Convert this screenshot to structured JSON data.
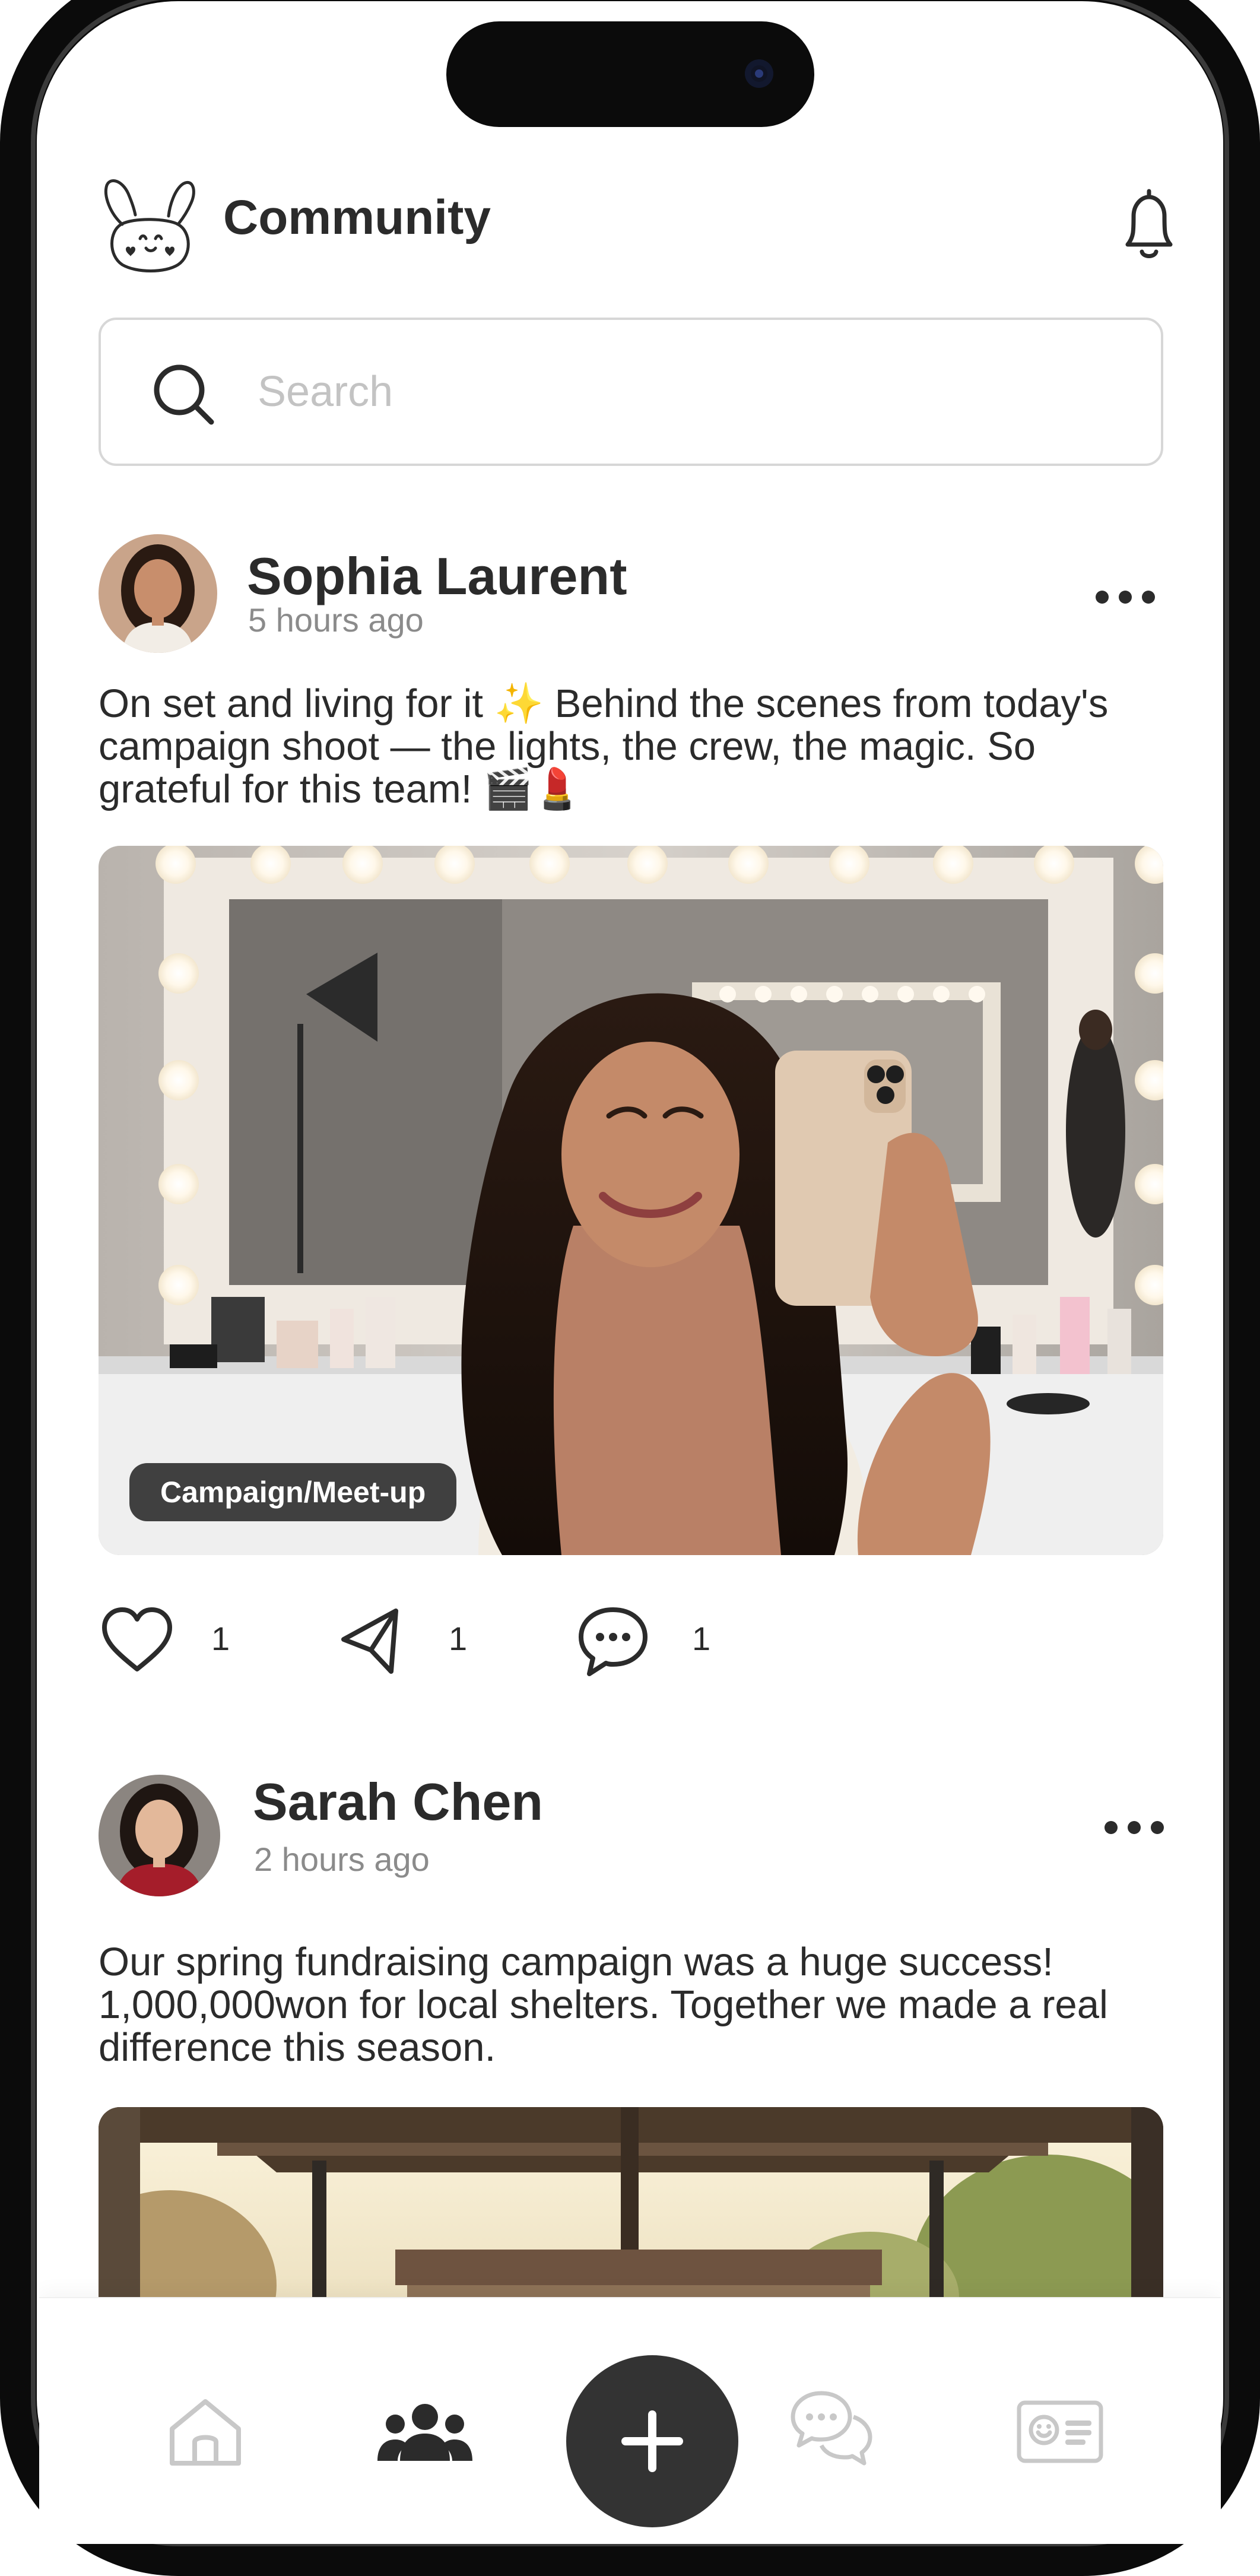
{
  "header": {
    "title": "Community",
    "logo_icon": "bunny-logo-icon",
    "notification_icon": "bell-icon"
  },
  "search": {
    "placeholder": "Search",
    "value": ""
  },
  "posts": [
    {
      "author": "Sophia Laurent",
      "time": "5 hours ago",
      "text": "On set and living for it ✨ Behind the scenes from today's campaign shoot — the lights, the crew, the magic. So grateful for this team! 🎬💄",
      "image_tag": "Campaign/Meet-up",
      "likes": "1",
      "shares": "1",
      "comments": "1"
    },
    {
      "author": "Sarah Chen",
      "time": "2 hours ago",
      "text": "Our spring fundraising campaign was a huge success! 1,000,000won for local shelters. Together we made a real difference this season."
    }
  ],
  "tabbar": {
    "tabs": [
      {
        "name": "home",
        "icon": "home-icon",
        "active": false
      },
      {
        "name": "community",
        "icon": "people-icon",
        "active": true
      },
      {
        "name": "create",
        "icon": "plus-icon",
        "active": false
      },
      {
        "name": "chat",
        "icon": "chat-bubbles-icon",
        "active": false
      },
      {
        "name": "profile",
        "icon": "id-card-icon",
        "active": false
      }
    ]
  },
  "colors": {
    "text": "#2b2b2b",
    "muted": "#8b8b8b",
    "inactive_tab": "#c8c8c8",
    "fab": "#333333",
    "tag_bg": "#2e2e2e"
  }
}
